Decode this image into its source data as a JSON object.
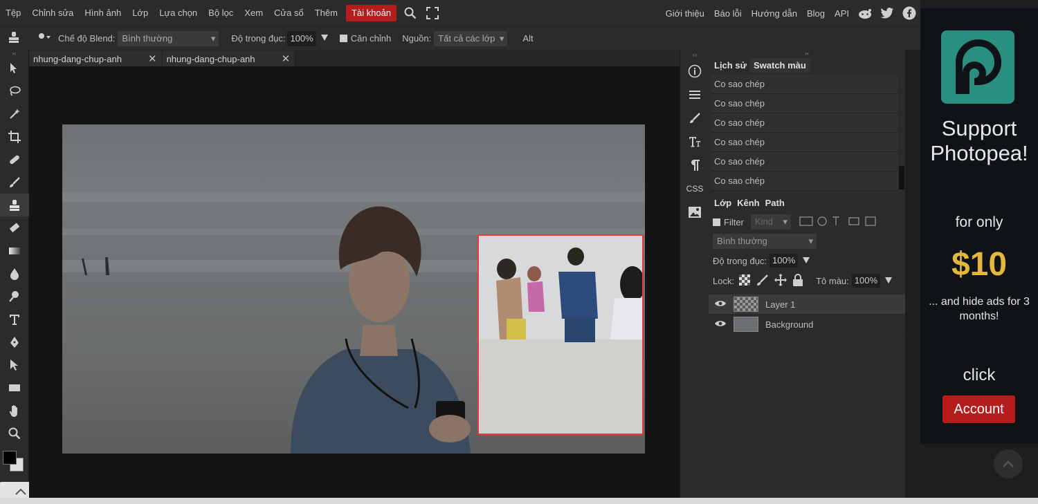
{
  "menu": {
    "items": [
      "Tệp",
      "Chỉnh sửa",
      "Hình ảnh",
      "Lớp",
      "Lựa chọn",
      "Bộ lọc",
      "Xem",
      "Cửa sổ",
      "Thêm"
    ],
    "account": "Tài khoản",
    "right_links": [
      "Giới thiệu",
      "Báo lỗi",
      "Hướng dẫn",
      "Blog",
      "API"
    ]
  },
  "options": {
    "blend_label": "Chế độ Blend:",
    "blend_value": "Bình thường",
    "opacity_label": "Độ trong đục:",
    "opacity_value": "100%",
    "align_label": "Căn chỉnh",
    "source_label": "Nguồn:",
    "source_value": "Tất cả các lớp",
    "alt_label": "Alt"
  },
  "doc_tabs": [
    {
      "name": "nhung-dang-chup-anh"
    },
    {
      "name": "nhung-dang-chup-anh"
    }
  ],
  "history_panel": {
    "tabs": [
      "Lịch sử",
      "Swatch màu"
    ],
    "rows": [
      "Co sao chép",
      "Co sao chép",
      "Co sao chép",
      "Co sao chép",
      "Co sao chép",
      "Co sao chép"
    ]
  },
  "layers_panel": {
    "tabs": [
      "Lớp",
      "Kênh",
      "Path"
    ],
    "filter_label": "Filter",
    "filter_kind": "Kind",
    "blend_value": "Bình thường",
    "opacity_label": "Độ trong đục:",
    "opacity_value": "100%",
    "lock_label": "Lock:",
    "fill_label": "Tô màu:",
    "fill_value": "100%",
    "layers": [
      {
        "name": "Layer 1",
        "selected": true
      },
      {
        "name": "Background",
        "selected": false
      }
    ]
  },
  "side_strip": {
    "css_label": "CSS"
  },
  "ad": {
    "title": "Support Photopea!",
    "for_only": "for only",
    "price": "$10",
    "hide_ads": "... and hide ads for 3 months!",
    "click": "click",
    "account_button": "Account"
  },
  "colors": {
    "accent_red": "#b51d1d",
    "selection_border": "#e53b3b",
    "logo_teal": "#2a8e80",
    "price_gold": "#e1b83a",
    "foreground_swatch": "#000000",
    "background_swatch": "#dcdcdc"
  }
}
